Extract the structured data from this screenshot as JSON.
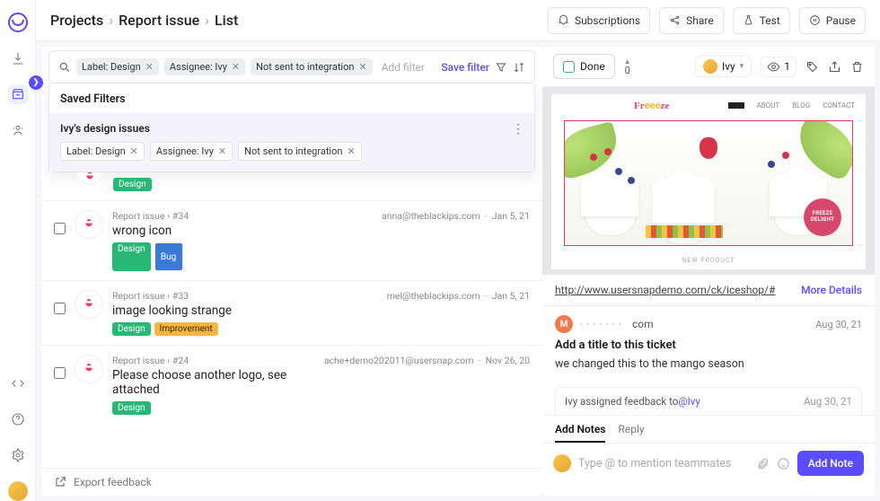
{
  "breadcrumbs": [
    "Projects",
    "Report issue",
    "List"
  ],
  "topbar": {
    "subscriptions": "Subscriptions",
    "share": "Share",
    "test": "Test",
    "pause": "Pause"
  },
  "filters": {
    "chips": [
      {
        "label": "Label: Design"
      },
      {
        "label": "Assignee: Ivy"
      },
      {
        "label": "Not sent to integration"
      }
    ],
    "add_placeholder": "Add filter",
    "save": "Save filter"
  },
  "saved_filters": {
    "heading": "Saved Filters",
    "items": [
      {
        "title": "Ivy's design issues",
        "chips": [
          "Label: Design",
          "Assignee: Ivy",
          "Not sent to integration"
        ]
      }
    ]
  },
  "issues": [
    {
      "path": "",
      "title": "",
      "labels": [
        "Design"
      ],
      "author": "",
      "date": "",
      "partial": true
    },
    {
      "path": "Report issue › #34",
      "title": "wrong icon",
      "labels": [
        "Design",
        "Bug"
      ],
      "author": "anna@theblackips.com",
      "date": "Jan 5, 21"
    },
    {
      "path": "Report issue › #33",
      "title": "image looking strange",
      "labels": [
        "Design",
        "Improvement"
      ],
      "author": "mel@theblackips.com",
      "date": "Jan 5, 21"
    },
    {
      "path": "Report issue › #24",
      "title": "Please choose another logo, see attached",
      "labels": [
        "Design"
      ],
      "author": "ache+demo202011@usersnap.com",
      "date": "Nov 26, 20"
    }
  ],
  "export": "Export feedback",
  "detail": {
    "done": "Done",
    "priority": "0",
    "assignee": "Ivy",
    "views": "1",
    "screenshot": {
      "brand": "Freeeze",
      "nav": [
        "ABOUT",
        "BLOG",
        "CONTACT"
      ],
      "badge_top": "FREEZE",
      "badge_bottom": "DELIGHT",
      "caption": "NEW PRODUCT"
    },
    "url": "http://www.usersnapdemo.com/ck/iceshop/#",
    "more": "More Details",
    "poster_initial": "M",
    "poster_suffix": "com",
    "poster_date": "Aug 30, 21",
    "title": "Add a title to this ticket",
    "desc": "we changed this to the mango season",
    "assign_event_prefix": "Ivy assigned feedback to ",
    "assign_event_who": "@Ivy",
    "assign_event_date": "Aug 30, 21",
    "tabs": {
      "notes": "Add Notes",
      "reply": "Reply"
    },
    "note_placeholder": "Type @ to mention teammates",
    "add_note": "Add Note"
  }
}
